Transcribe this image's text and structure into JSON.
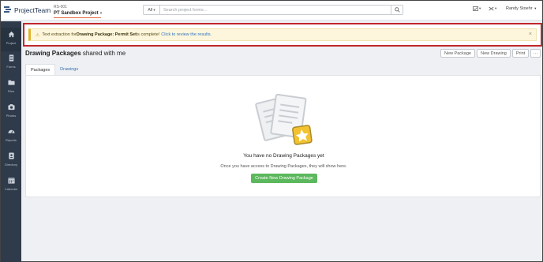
{
  "header": {
    "logo_text": "ProjectTeam",
    "project_code": "RS-001",
    "project_name": "PT Sandbox Project",
    "search": {
      "scope": "All",
      "placeholder": "Search project forms..."
    },
    "user_name": "Randy Stoehr"
  },
  "sidebar": {
    "items": [
      {
        "label": "Project",
        "icon": "home-icon"
      },
      {
        "label": "Forms",
        "icon": "forms-icon"
      },
      {
        "label": "Files",
        "icon": "folder-icon"
      },
      {
        "label": "Photos",
        "icon": "camera-icon"
      },
      {
        "label": "Reports",
        "icon": "gauge-icon"
      },
      {
        "label": "Directory",
        "icon": "address-book-icon"
      },
      {
        "label": "Calendar",
        "icon": "calendar-icon"
      }
    ]
  },
  "alert": {
    "prefix": "Text extraction for ",
    "bold": "Drawing Package: Permit Set",
    "suffix": " is complete!",
    "link": "Click to review the results.",
    "close": "×"
  },
  "page": {
    "title_bold": "Drawing Packages",
    "title_rest": " shared with me",
    "actions": {
      "new_package": "New Package",
      "new_drawing": "New Drawing",
      "print": "Print",
      "more": "···"
    },
    "tabs": [
      "Packages",
      "Drawings"
    ]
  },
  "empty_state": {
    "title": "You have no Drawing Packages yet",
    "subtitle": "Once you have access to Drawing Packages, they will show here.",
    "button": "Create New Drawing Package"
  },
  "colors": {
    "sidebar_bg": "#2f3b4a",
    "alert_outline": "#c0282d",
    "create_button": "#5cb85c",
    "link": "#2f74c0"
  }
}
